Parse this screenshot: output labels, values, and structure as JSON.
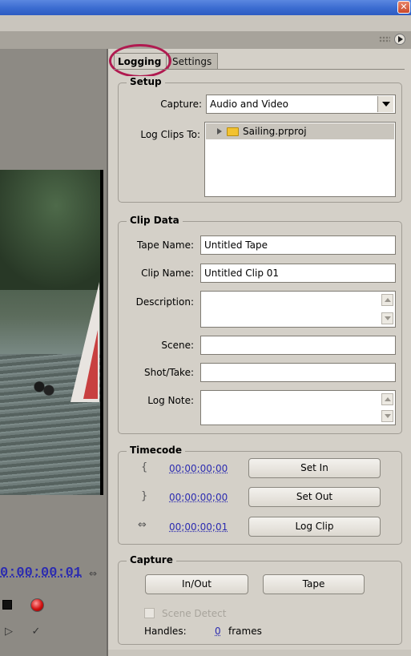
{
  "window": {
    "close_glyph": "✕"
  },
  "panel": {
    "menu_icon": "panel-menu-icon"
  },
  "monitor": {
    "timecode": "0:00:00:01"
  },
  "tabs": [
    {
      "label": "Logging",
      "active": true
    },
    {
      "label": "Settings",
      "active": false
    }
  ],
  "setup": {
    "title": "Setup",
    "capture_label": "Capture:",
    "capture_value": "Audio and Video",
    "log_clips_label": "Log Clips To:",
    "project_item": "Sailing.prproj"
  },
  "clip_data": {
    "title": "Clip Data",
    "tape_name_label": "Tape Name:",
    "tape_name_value": "Untitled Tape",
    "clip_name_label": "Clip Name:",
    "clip_name_value": "Untitled Clip 01",
    "description_label": "Description:",
    "scene_label": "Scene:",
    "shot_take_label": "Shot/Take:",
    "log_note_label": "Log Note:"
  },
  "timecode": {
    "title": "Timecode",
    "in_value": "00;00;00;00",
    "out_value": "00;00;00;00",
    "duration_value": "00;00;00;01",
    "set_in_label": "Set In",
    "set_out_label": "Set Out",
    "log_clip_label": "Log Clip"
  },
  "capture": {
    "title": "Capture",
    "in_out_label": "In/Out",
    "tape_label": "Tape",
    "scene_detect_label": "Scene Detect",
    "handles_label": "Handles:",
    "handles_value": "0",
    "frames_label": "frames"
  }
}
